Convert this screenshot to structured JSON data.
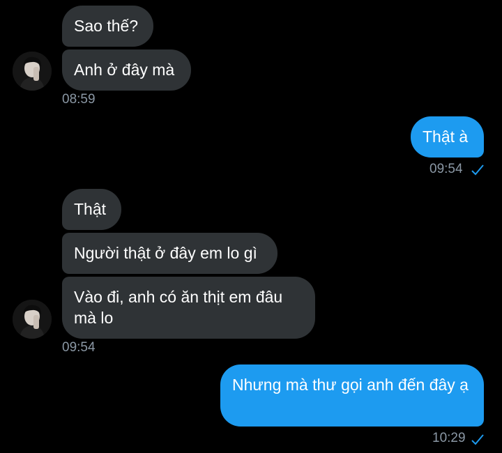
{
  "colors": {
    "background": "#000000",
    "incoming_bubble": "#2f3336",
    "outgoing_bubble": "#1d9bf0",
    "timestamp": "#8b98a5"
  },
  "messages": [
    {
      "direction": "incoming",
      "text": "Sao thế?"
    },
    {
      "direction": "incoming",
      "text": "Anh ở đây mà"
    },
    {
      "direction": "meta",
      "time": "08:59"
    },
    {
      "direction": "outgoing",
      "text": "Thật à"
    },
    {
      "direction": "meta",
      "time": "09:54",
      "status_icon": "check-icon"
    },
    {
      "direction": "incoming",
      "text": "Thật"
    },
    {
      "direction": "incoming",
      "text": "Người thật ở đây em lo gì"
    },
    {
      "direction": "incoming",
      "text": "Vào đi, anh có ăn thịt em đâu mà lo"
    },
    {
      "direction": "meta",
      "time": "09:54"
    },
    {
      "direction": "outgoing",
      "text": "Nhưng mà thư gọi anh đến đây ạ"
    },
    {
      "direction": "meta",
      "time": "10:29",
      "status_icon": "check-icon"
    }
  ]
}
